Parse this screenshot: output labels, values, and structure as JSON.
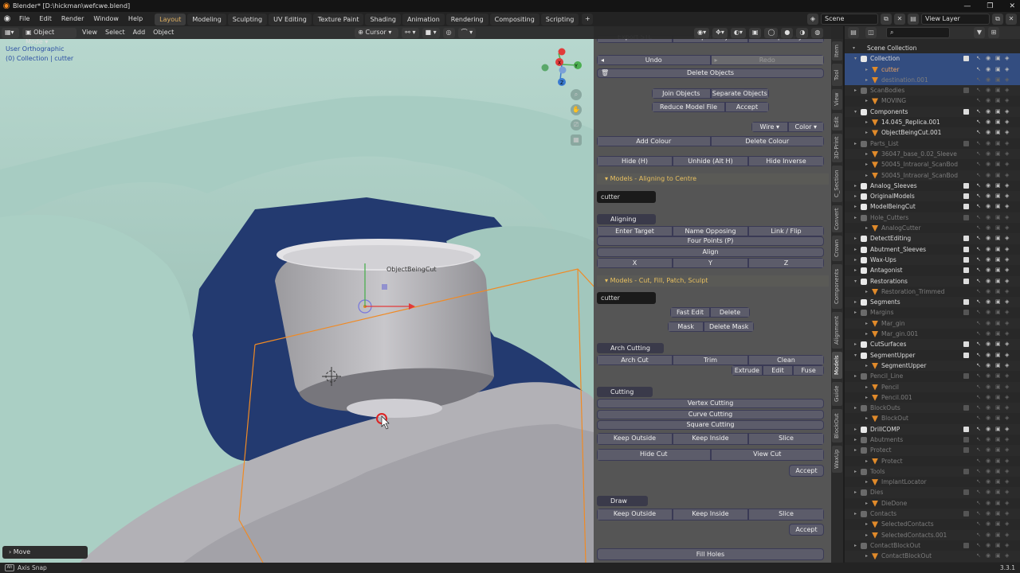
{
  "titlebar": {
    "title": "Blender* [D:\\hickman\\wefcwe.blend]"
  },
  "menubar": {
    "menus": [
      "File",
      "Edit",
      "Render",
      "Window",
      "Help"
    ],
    "workspaces": [
      "Layout",
      "Modeling",
      "Sculpting",
      "UV Editing",
      "Texture Paint",
      "Shading",
      "Animation",
      "Rendering",
      "Compositing",
      "Scripting"
    ],
    "scene": "Scene",
    "view_layer": "View Layer"
  },
  "viewport_header": {
    "mode": "Object Mode",
    "menus": [
      "View",
      "Select",
      "Add",
      "Object"
    ],
    "pivot": "Cursor"
  },
  "viewport": {
    "view_name": "User Orthographic",
    "collection_line": "(0) Collection | cutter",
    "object_label": "ObjectBeingCut",
    "gizmo": {
      "x": "X",
      "y": "Y",
      "z": "Z"
    },
    "move_panel": "Move",
    "tool_hint": "Axis Snap"
  },
  "tabs": [
    "Item",
    "Tool",
    "View",
    "Edit",
    "3D-Print",
    "C_Section",
    "Convert",
    "Crown",
    "Components",
    "Alignment",
    "Models",
    "Guide",
    "BlockOut",
    "WaxUp"
  ],
  "active_tab": "Models",
  "panel": {
    "top_partial": [
      "Export STL",
      "Export Obj",
      "Export Ply"
    ],
    "undo": "Undo",
    "redo": "Redo",
    "delete_objects": "Delete Objects",
    "join": "Join Objects",
    "separate": "Separate Objects",
    "reduce": "Reduce Model File",
    "accept": "Accept",
    "wire": "Wire",
    "color": "Color",
    "add_colour": "Add Colour",
    "delete_colour": "Delete Colour",
    "hide": "Hide (H)",
    "unhide": "Unhide (Alt H)",
    "hide_inverse": "Hide Inverse",
    "sec_align": "Models - Aligning to Centre",
    "align_obj": "cutter",
    "aligning_scans": "Aligning Scans",
    "enter_target": "Enter Target",
    "name_opposing": "Name Opposing",
    "link_flip": "Link / Flip",
    "four_points": "Four Points (P)",
    "align": "Align",
    "ax": "X",
    "ay": "Y",
    "az": "Z",
    "sec_cut": "Models - Cut, Fill, Patch, Sculpt",
    "cut_obj": "cutter",
    "fast_edit": "Fast Edit",
    "delete": "Delete",
    "mask": "Mask",
    "delete_mask": "Delete Mask",
    "arch_tool": "Arch Cutting Tool",
    "arch_cut": "Arch Cut",
    "trim": "Trim",
    "clean": "Clean",
    "extrude": "Extrude",
    "edit": "Edit",
    "fuse": "Fuse",
    "cutting_tools": "Cutting Tools",
    "vertex_cutting": "Vertex Cutting",
    "curve_cutting": "Curve Cutting",
    "square_cutting": "Square Cutting",
    "keep_outside": "Keep Outside",
    "keep_inside": "Keep Inside",
    "slice": "Slice",
    "hide_cut": "Hide Cut",
    "view_cut": "View Cut",
    "accept2": "Accept",
    "draw_lasso": "Draw Lasso",
    "keep_outside2": "Keep Outside",
    "keep_inside2": "Keep Inside",
    "slice2": "Slice",
    "accept3": "Accept",
    "fill_holes": "Fill Holes"
  },
  "outliner": {
    "root": "Scene Collection",
    "rows": [
      {
        "name": "Collection",
        "indent": 1,
        "type": "coll",
        "open": true,
        "dim": false,
        "sel": true
      },
      {
        "name": "cutter",
        "indent": 2,
        "type": "mesh",
        "dim": false,
        "sel": true,
        "hi": true
      },
      {
        "name": "destination.001",
        "indent": 2,
        "type": "mesh",
        "dim": true,
        "sel": true
      },
      {
        "name": "ScanBodies",
        "indent": 1,
        "type": "coll",
        "dim": true
      },
      {
        "name": "MOVING",
        "indent": 2,
        "type": "mesh",
        "dim": true
      },
      {
        "name": "Components",
        "indent": 1,
        "type": "coll",
        "open": true,
        "dim": false
      },
      {
        "name": "14.045_Replica.001",
        "indent": 2,
        "type": "mesh",
        "dim": false
      },
      {
        "name": "ObjectBeingCut.001",
        "indent": 2,
        "type": "mesh",
        "dim": false
      },
      {
        "name": "Parts_List",
        "indent": 1,
        "type": "coll",
        "dim": true
      },
      {
        "name": "36047_base_0.02_Sleeve",
        "indent": 2,
        "type": "mesh",
        "dim": true
      },
      {
        "name": "50045_Intraoral_ScanBod",
        "indent": 2,
        "type": "mesh",
        "dim": true
      },
      {
        "name": "50045_Intraoral_ScanBod",
        "indent": 2,
        "type": "mesh",
        "dim": true
      },
      {
        "name": "Analog_Sleeves",
        "indent": 1,
        "type": "coll",
        "dim": false
      },
      {
        "name": "OriginalModels",
        "indent": 1,
        "type": "coll",
        "dim": false
      },
      {
        "name": "ModelBeingCut",
        "indent": 1,
        "type": "coll",
        "dim": false
      },
      {
        "name": "Hole_Cutters",
        "indent": 1,
        "type": "coll",
        "dim": true
      },
      {
        "name": "AnalogCutter",
        "indent": 2,
        "type": "mesh",
        "dim": true
      },
      {
        "name": "DetectEditing",
        "indent": 1,
        "type": "coll",
        "dim": false
      },
      {
        "name": "Abutment_Sleeves",
        "indent": 1,
        "type": "coll",
        "dim": false
      },
      {
        "name": "Wax-Ups",
        "indent": 1,
        "type": "coll",
        "dim": false
      },
      {
        "name": "Antagonist",
        "indent": 1,
        "type": "coll",
        "dim": false
      },
      {
        "name": "Restorations",
        "indent": 1,
        "type": "coll",
        "open": true,
        "dim": false
      },
      {
        "name": "Restoration_Trimmed",
        "indent": 2,
        "type": "mesh",
        "dim": true
      },
      {
        "name": "Segments",
        "indent": 1,
        "type": "coll",
        "dim": false
      },
      {
        "name": "Margins",
        "indent": 1,
        "type": "coll",
        "dim": true
      },
      {
        "name": "Mar_gin",
        "indent": 2,
        "type": "mesh",
        "dim": true
      },
      {
        "name": "Mar_gin.001",
        "indent": 2,
        "type": "mesh",
        "dim": true
      },
      {
        "name": "CutSurfaces",
        "indent": 1,
        "type": "coll",
        "dim": false
      },
      {
        "name": "SegmentUpper",
        "indent": 1,
        "type": "coll",
        "open": true,
        "dim": false
      },
      {
        "name": "SegmentUpper",
        "indent": 2,
        "type": "mesh",
        "dim": false
      },
      {
        "name": "Pencil_Line",
        "indent": 1,
        "type": "coll",
        "dim": true
      },
      {
        "name": "Pencil",
        "indent": 2,
        "type": "mesh",
        "dim": true
      },
      {
        "name": "Pencil.001",
        "indent": 2,
        "type": "mesh",
        "dim": true
      },
      {
        "name": "BlockOuts",
        "indent": 1,
        "type": "coll",
        "dim": true
      },
      {
        "name": "BlockOut",
        "indent": 2,
        "type": "mesh",
        "dim": true
      },
      {
        "name": "DrillCOMP",
        "indent": 1,
        "type": "coll",
        "dim": false
      },
      {
        "name": "Abutments",
        "indent": 1,
        "type": "coll",
        "dim": true
      },
      {
        "name": "Protect",
        "indent": 1,
        "type": "coll",
        "dim": true
      },
      {
        "name": "Protect",
        "indent": 2,
        "type": "mesh",
        "dim": true
      },
      {
        "name": "Tools",
        "indent": 1,
        "type": "coll",
        "dim": true
      },
      {
        "name": "ImplantLocator",
        "indent": 2,
        "type": "mesh",
        "dim": true
      },
      {
        "name": "Dies",
        "indent": 1,
        "type": "coll",
        "dim": true
      },
      {
        "name": "DieDone",
        "indent": 2,
        "type": "mesh",
        "dim": true
      },
      {
        "name": "Contacts",
        "indent": 1,
        "type": "coll",
        "dim": true
      },
      {
        "name": "SelectedContacts",
        "indent": 2,
        "type": "mesh",
        "dim": true
      },
      {
        "name": "SelectedContacts.001",
        "indent": 2,
        "type": "mesh",
        "dim": true
      },
      {
        "name": "ContactBlockOut",
        "indent": 1,
        "type": "coll",
        "dim": true
      },
      {
        "name": "ContactBlockOut",
        "indent": 2,
        "type": "mesh",
        "dim": true
      }
    ]
  },
  "status": {
    "version": "3.3.1"
  },
  "colors": {
    "accent": "#e0b060",
    "selection": "#334d80",
    "panel": "#555555",
    "button": "#5c5c6a"
  }
}
